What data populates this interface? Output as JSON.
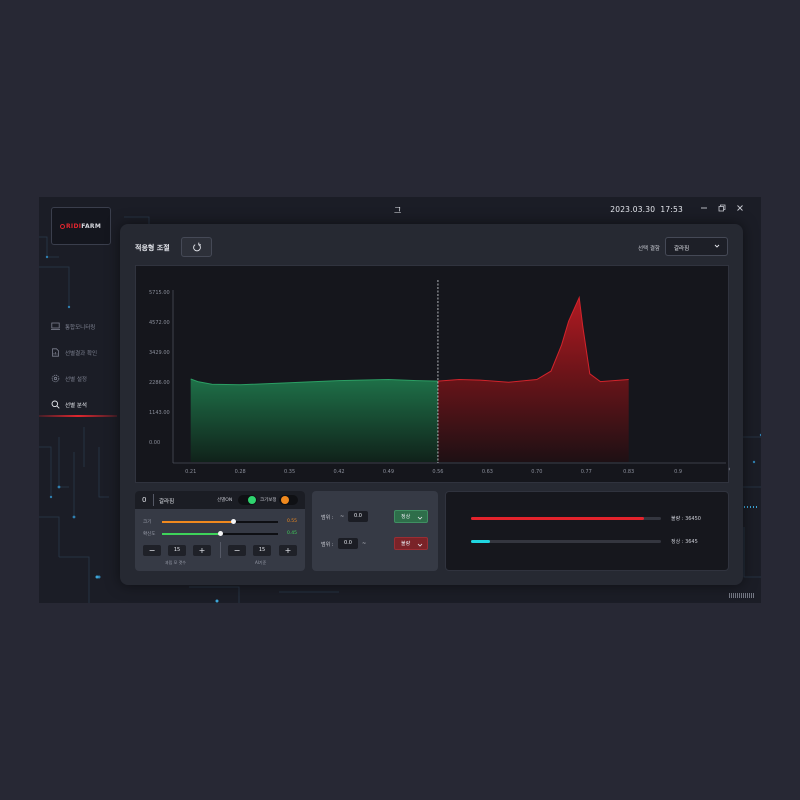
{
  "window": {
    "title": "그",
    "date": "2023.03.30",
    "time": "17:53"
  },
  "logo": {
    "part1": "RIDI",
    "part2": "FARM"
  },
  "sidebar": {
    "items": [
      {
        "label": "통합모니터링",
        "icon": "monitor-icon",
        "active": false
      },
      {
        "label": "선별결과 확인",
        "icon": "document-chart-icon",
        "active": false
      },
      {
        "label": "선별 설정",
        "icon": "gear-icon",
        "active": false
      },
      {
        "label": "선별 분석",
        "icon": "search-icon",
        "active": true
      }
    ]
  },
  "panel": {
    "title": "적응형 조절",
    "select_label": "선택 결함",
    "select_value": "갈라짐"
  },
  "chart_data": {
    "type": "area",
    "x_ticks": [
      "0.21",
      "0.28",
      "0.35",
      "0.42",
      "0.49",
      "0.56",
      "0.63",
      "0.70",
      "0.77",
      "0.83",
      "0.9"
    ],
    "y_ticks": [
      "0.00",
      "1143.00",
      "2286.00",
      "3429.00",
      "4572.00",
      "5715.00"
    ],
    "threshold_x": 0.56,
    "series": [
      {
        "color": "#2b9e63",
        "x": [
          0.21,
          0.22,
          0.24,
          0.28,
          0.35,
          0.42,
          0.49,
          0.53,
          0.56
        ],
        "y": [
          2400,
          2300,
          2200,
          2180,
          2260,
          2340,
          2380,
          2340,
          2320
        ]
      },
      {
        "color": "#d2232b",
        "x": [
          0.56,
          0.59,
          0.62,
          0.66,
          0.7,
          0.72,
          0.735,
          0.745,
          0.76,
          0.765,
          0.775,
          0.79,
          0.83
        ],
        "y": [
          2320,
          2380,
          2360,
          2280,
          2380,
          2700,
          3700,
          4600,
          5500,
          4400,
          2600,
          2300,
          2380
        ]
      }
    ]
  },
  "defect_card": {
    "number": "0",
    "name": "갈라짐",
    "toggle1_label": "선별ON",
    "toggle1_color": "#2fd46f",
    "toggle2_label": "크기보정",
    "toggle2_color": "#f0891e",
    "sliders": [
      {
        "label": "크기",
        "value": "0.55",
        "fraction": 0.62,
        "color": "#f0891e"
      },
      {
        "label": "확신도",
        "value": "0.45",
        "fraction": 0.5,
        "color": "#3ed35a"
      }
    ],
    "stepper1": {
      "value": "15",
      "caption": "과립 모 갯수"
    },
    "stepper2": {
      "value": "15",
      "caption": "AI기준"
    },
    "minus": "−",
    "plus": "+"
  },
  "range_card": {
    "row1": {
      "label": "범위 :",
      "tilde": "~",
      "value": "0.0",
      "badge": "정상"
    },
    "row2": {
      "label": "범위 :",
      "tilde": "~",
      "value": "0.0",
      "badge": "불량"
    }
  },
  "stats_card": {
    "bad": {
      "label": "불량 : 36450",
      "fraction": 0.91,
      "color": "#e4232c"
    },
    "normal": {
      "label": "정상 : 3645",
      "fraction": 0.1,
      "color": "#1fd6e0"
    }
  }
}
